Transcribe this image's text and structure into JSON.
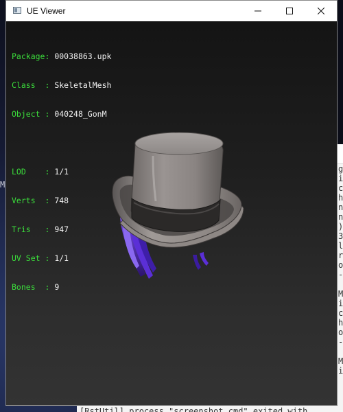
{
  "window": {
    "title": "UE Viewer",
    "controls": {
      "minimize": "minimize",
      "maximize": "maximize",
      "close": "close"
    }
  },
  "info": {
    "rows": [
      {
        "key": "Package:",
        "value": "00038863.upk"
      },
      {
        "key": "Class  :",
        "value": "SkeletalMesh"
      },
      {
        "key": "Object :",
        "value": "040248_GonM"
      },
      {
        "key": "",
        "value": ""
      },
      {
        "key": "LOD    :",
        "value": "1/1"
      },
      {
        "key": "Verts  :",
        "value": "748"
      },
      {
        "key": "Tris   :",
        "value": "947"
      },
      {
        "key": "UV Set :",
        "value": "1/1"
      },
      {
        "key": "Bones  :",
        "value": "9"
      }
    ]
  },
  "background": {
    "left_letter": "M",
    "console_lines": [
      "g",
      "i",
      "c",
      "h",
      "n",
      "n",
      ")",
      "3",
      "l",
      "r",
      "o",
      "-",
      "",
      "M",
      "i",
      "c",
      "h",
      "o",
      "-",
      "",
      "M",
      "i"
    ],
    "console_bottom": "[RstUtil] process \"screenshot.cmd\" exited with"
  },
  "colors": {
    "key_text": "#3bdc3b",
    "value_text": "#f2f2f2",
    "hair_purple": "#5b2fd6"
  }
}
